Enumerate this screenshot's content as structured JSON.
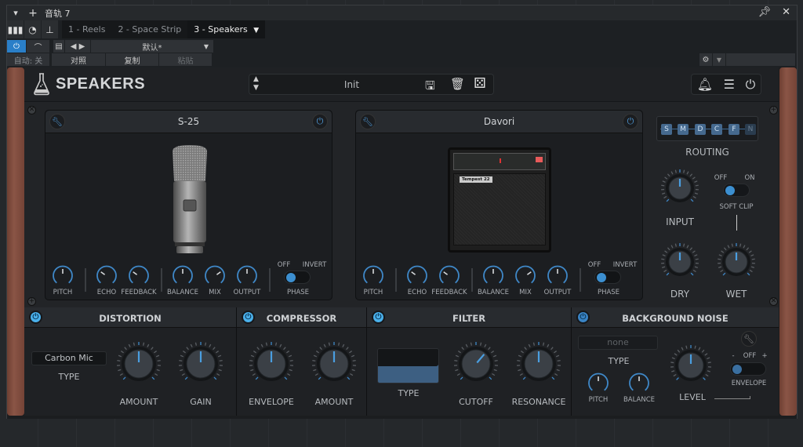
{
  "window": {
    "track_title": "音轨 7",
    "tabs": [
      {
        "label": "1 - Reels",
        "active": false
      },
      {
        "label": "2 - Space Strip",
        "active": false
      },
      {
        "label": "3 - Speakers",
        "active": true
      }
    ],
    "preset_default": "默认*",
    "auto_label": "自动: 关",
    "compare_label": "对照",
    "copy_label": "复制",
    "paste_label": "粘贴"
  },
  "plugin": {
    "name": "SPEAKERS",
    "preset_name": "Init",
    "accent_color": "#3c8fd0",
    "slots": [
      {
        "title": "S-25",
        "image": "condenser-microphone",
        "knobs": [
          {
            "label": "PITCH",
            "value": 0.5
          },
          {
            "label": "ECHO",
            "value": 0.3
          },
          {
            "label": "FEEDBACK",
            "value": 0.3
          },
          {
            "label": "BALANCE",
            "value": 0.5
          },
          {
            "label": "MIX",
            "value": 0.7
          },
          {
            "label": "OUTPUT",
            "value": 0.5
          }
        ],
        "phase": {
          "off_label": "OFF",
          "on_label": "INVERT",
          "label": "PHASE",
          "state": "OFF"
        }
      },
      {
        "title": "Davori",
        "image": "guitar-amplifier",
        "amp_badge": "Tempest 22",
        "knobs": [
          {
            "label": "PITCH",
            "value": 0.5
          },
          {
            "label": "ECHO",
            "value": 0.3
          },
          {
            "label": "FEEDBACK",
            "value": 0.3
          },
          {
            "label": "BALANCE",
            "value": 0.5
          },
          {
            "label": "MIX",
            "value": 0.7
          },
          {
            "label": "OUTPUT",
            "value": 0.5
          }
        ],
        "phase": {
          "off_label": "OFF",
          "on_label": "INVERT",
          "label": "PHASE",
          "state": "OFF"
        }
      }
    ],
    "routing": {
      "label": "ROUTING",
      "buttons": [
        {
          "label": "S",
          "active": true
        },
        {
          "label": "M",
          "active": true
        },
        {
          "label": "D",
          "active": true
        },
        {
          "label": "C",
          "active": true
        },
        {
          "label": "F",
          "active": true
        },
        {
          "label": "N",
          "active": false
        }
      ]
    },
    "input": {
      "label": "INPUT",
      "value": 0.5
    },
    "soft_clip": {
      "off_label": "OFF",
      "on_label": "ON",
      "label": "SOFT CLIP",
      "state": "OFF"
    },
    "dry": {
      "label": "DRY",
      "value": 0.5
    },
    "wet": {
      "label": "WET",
      "value": 0.5
    },
    "sections": {
      "distortion": {
        "title": "DISTORTION",
        "type_value": "Carbon Mic",
        "type_label": "TYPE",
        "amount": {
          "label": "AMOUNT",
          "value": 0.5
        },
        "gain": {
          "label": "GAIN",
          "value": 0.5
        }
      },
      "compressor": {
        "title": "COMPRESSOR",
        "envelope": {
          "label": "ENVELOPE",
          "value": 0.5
        },
        "amount": {
          "label": "AMOUNT",
          "value": 0.5
        }
      },
      "filter": {
        "title": "FILTER",
        "type_label": "TYPE",
        "cutoff": {
          "label": "CUTOFF",
          "value": 0.65
        },
        "resonance": {
          "label": "RESONANCE",
          "value": 0.5
        }
      },
      "noise": {
        "title": "BACKGROUND NOISE",
        "type_value": "none",
        "type_label": "TYPE",
        "pitch_label": "PITCH",
        "balance_label": "BALANCE",
        "level": {
          "label": "LEVEL",
          "value": 0.5
        },
        "envelope": {
          "minus": "-",
          "off": "OFF",
          "plus": "+",
          "label": "ENVELOPE",
          "state": "OFF"
        }
      }
    }
  }
}
